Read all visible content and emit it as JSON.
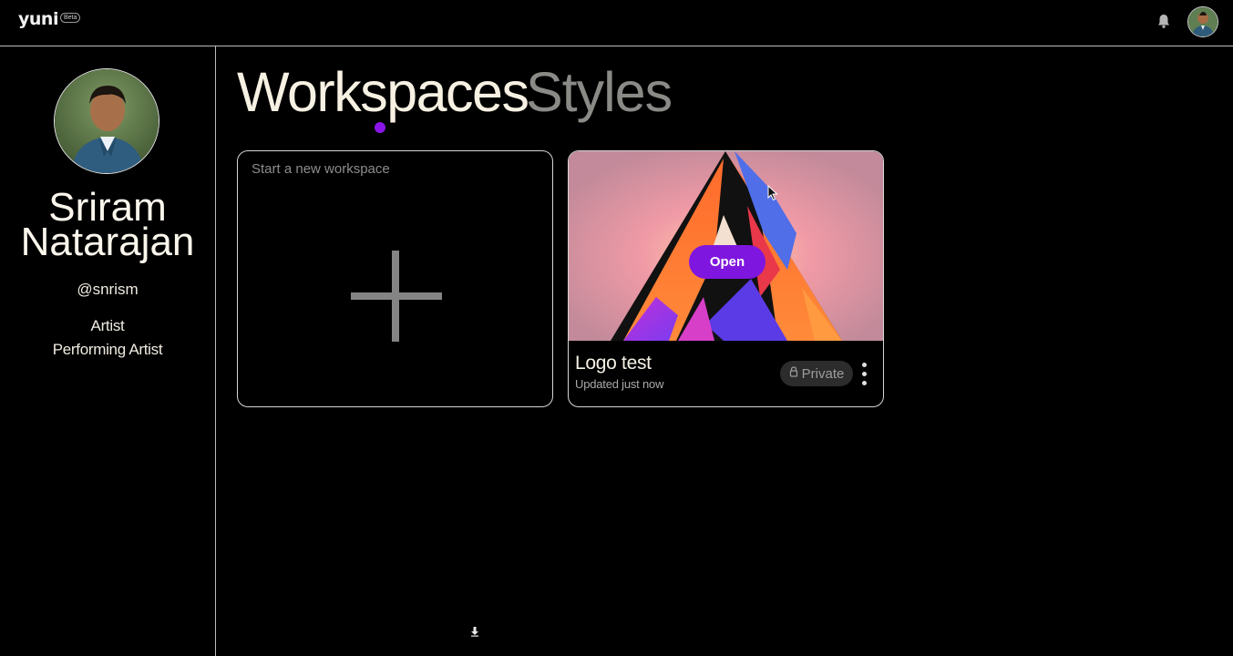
{
  "header": {
    "logo_text": "yuni",
    "beta_label": "Beta",
    "icons": [
      "bell-icon",
      "user-avatar"
    ]
  },
  "profile": {
    "first_name": "Sriram",
    "last_name": "Natarajan",
    "handle": "@snrism",
    "roles": [
      "Artist",
      "Performing Artist"
    ]
  },
  "tabs": {
    "workspaces": "Workspaces",
    "styles": "Styles",
    "active": "workspaces",
    "indicator_color": "#8a15e8"
  },
  "new_workspace": {
    "label": "Start a new workspace"
  },
  "workspaces": [
    {
      "title": "Logo test",
      "updated": "Updated just now",
      "visibility": "Private",
      "open_label": "Open"
    }
  ],
  "colors": {
    "accent": "#7f16df",
    "background": "#000000",
    "text": "#f4efe6"
  }
}
